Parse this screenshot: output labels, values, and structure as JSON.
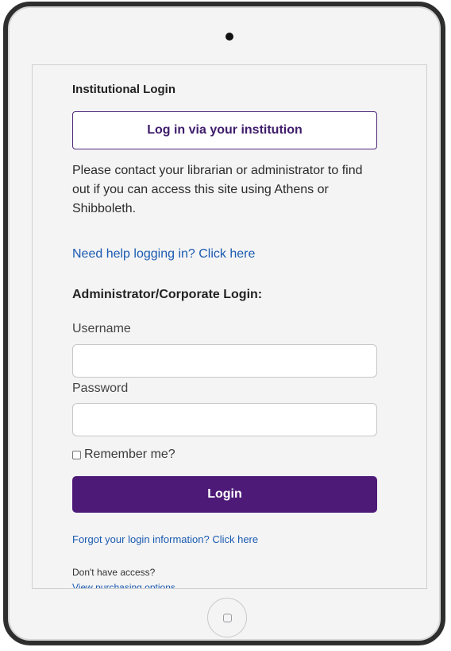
{
  "institutional": {
    "heading": "Institutional Login",
    "button_label": "Log in via your institution",
    "info_text": "Please contact your librarian or administrator to find out if you can access this site using Athens or Shibboleth.",
    "help_link": "Need help logging in? Click here"
  },
  "admin": {
    "heading": "Administrator/Corporate Login:",
    "username_label": "Username",
    "username_value": "",
    "password_label": "Password",
    "password_value": "",
    "remember_label": "Remember me?",
    "login_label": "Login",
    "forgot_link": "Forgot your login information? Click here"
  },
  "access": {
    "no_access_text": "Don't have access?",
    "purchase_link": "View purchasing options"
  },
  "colors": {
    "accent": "#4e1a78",
    "link": "#1a5bb0"
  },
  "icons": {
    "camera": "camera-dot-icon",
    "home": "home-button-icon",
    "checkbox": "checkbox-icon"
  }
}
